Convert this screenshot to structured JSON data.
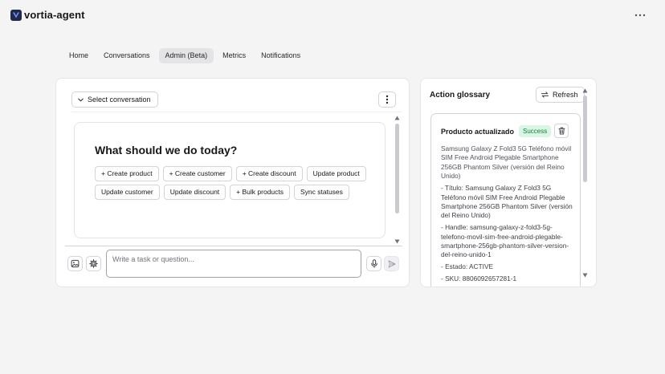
{
  "app": {
    "title": "vortia-agent"
  },
  "nav": {
    "tabs": [
      {
        "label": "Home",
        "active": false
      },
      {
        "label": "Conversations",
        "active": false
      },
      {
        "label": "Admin (Beta)",
        "active": true
      },
      {
        "label": "Metrics",
        "active": false
      },
      {
        "label": "Notifications",
        "active": false
      }
    ]
  },
  "chat": {
    "select_label": "Select conversation",
    "welcome_title": "What should we do today?",
    "quick_actions": [
      "+ Create product",
      "+ Create customer",
      "+ Create discount",
      "Update product",
      "Update customer",
      "Update discount",
      "+ Bulk products",
      "Sync statuses"
    ],
    "input_placeholder": "Write a task or question..."
  },
  "glossary": {
    "title": "Action glossary",
    "refresh_label": "Refresh",
    "entry": {
      "title": "Producto actualizado",
      "status": "Success",
      "summary": "Samsung Galaxy Z Fold3 5G Teléfono móvil SIM Free Android Plegable Smartphone 256GB Phantom Silver (versión del Reino Unido)",
      "details": [
        "- Título: Samsung Galaxy Z Fold3 5G Teléfono móvil SIM Free Android Plegable Smartphone 256GB Phantom Silver (versión del Reino Unido)",
        "- Handle: samsung-galaxy-z-fold3-5g-telefono-movil-sim-free-android-plegable-smartphone-256gb-phantom-silver-version-del-reino-unido-1",
        "- Estado: ACTIVE",
        "- SKU: 8806092657281-1"
      ]
    }
  },
  "colors": {
    "background": "#f4f4f5",
    "card": "#ffffff",
    "success_bg": "#d9f5e3",
    "success_text": "#15803d",
    "logo": "#1e2b4a"
  },
  "icons": {
    "logo": "v-logo-icon",
    "menu": "more-horizontal-icon",
    "select": "chevron-down-icon",
    "options": "more-vertical-icon",
    "attach": "image-icon",
    "settings": "gear-icon",
    "mic": "microphone-icon",
    "send": "send-icon",
    "refresh": "refresh-icon",
    "delete": "trash-icon"
  }
}
